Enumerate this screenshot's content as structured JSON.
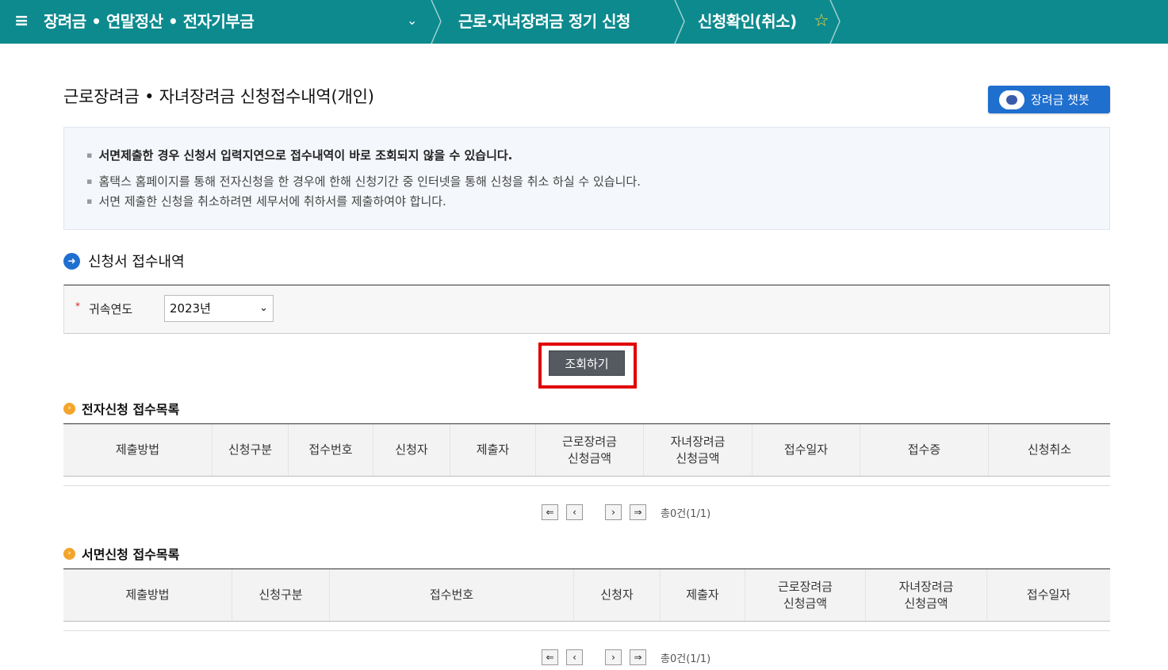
{
  "topnav": {
    "menu_label": "≡",
    "crumb1": "장려금 • 연말정산 • 전자기부금",
    "crumb2": "근로·자녀장려금 정기 신청",
    "crumb3": "신청확인(취소)"
  },
  "page": {
    "title": "근로장려금 • 자녀장려금 신청접수내역(개인)",
    "chatbot_label": "장려금 챗봇"
  },
  "notice": {
    "lines": [
      "서면제출한 경우 신청서 입력지연으로 접수내역이 바로 조회되지 않을 수 있습니다.",
      "홈택스 홈페이지를 통해 전자신청을 한 경우에 한해 신청기간 중 인터넷을 통해 신청을 취소 하실 수 있습니다.",
      "서면 제출한 신청을 취소하려면 세무서에 취하서를 제출하여야 합니다."
    ]
  },
  "section": {
    "title": "신청서 접수내역"
  },
  "filter": {
    "required_mark": "*",
    "year_label": "귀속연도",
    "year_value": "2023년"
  },
  "search_button": "조회하기",
  "electronic": {
    "title": "전자신청 접수목록",
    "columns": [
      "제출방법",
      "신청구분",
      "접수번호",
      "신청자",
      "제출자",
      "근로장려금\n신청금액",
      "자녀장려금\n신청금액",
      "접수일자",
      "접수증",
      "신청취소"
    ],
    "count_text": "총0건(1/1)"
  },
  "paper": {
    "title": "서면신청 접수목록",
    "columns": [
      "제출방법",
      "신청구분",
      "접수번호",
      "신청자",
      "제출자",
      "근로장려금\n신청금액",
      "자녀장려금\n신청금액",
      "접수일자"
    ],
    "count_text": "총0건(1/1)"
  },
  "colors": {
    "nav_bg": "#0d8a8e",
    "chatbot_bg": "#1f6fcf",
    "highlight": "#e00000",
    "search_btn_bg": "#555a61"
  }
}
